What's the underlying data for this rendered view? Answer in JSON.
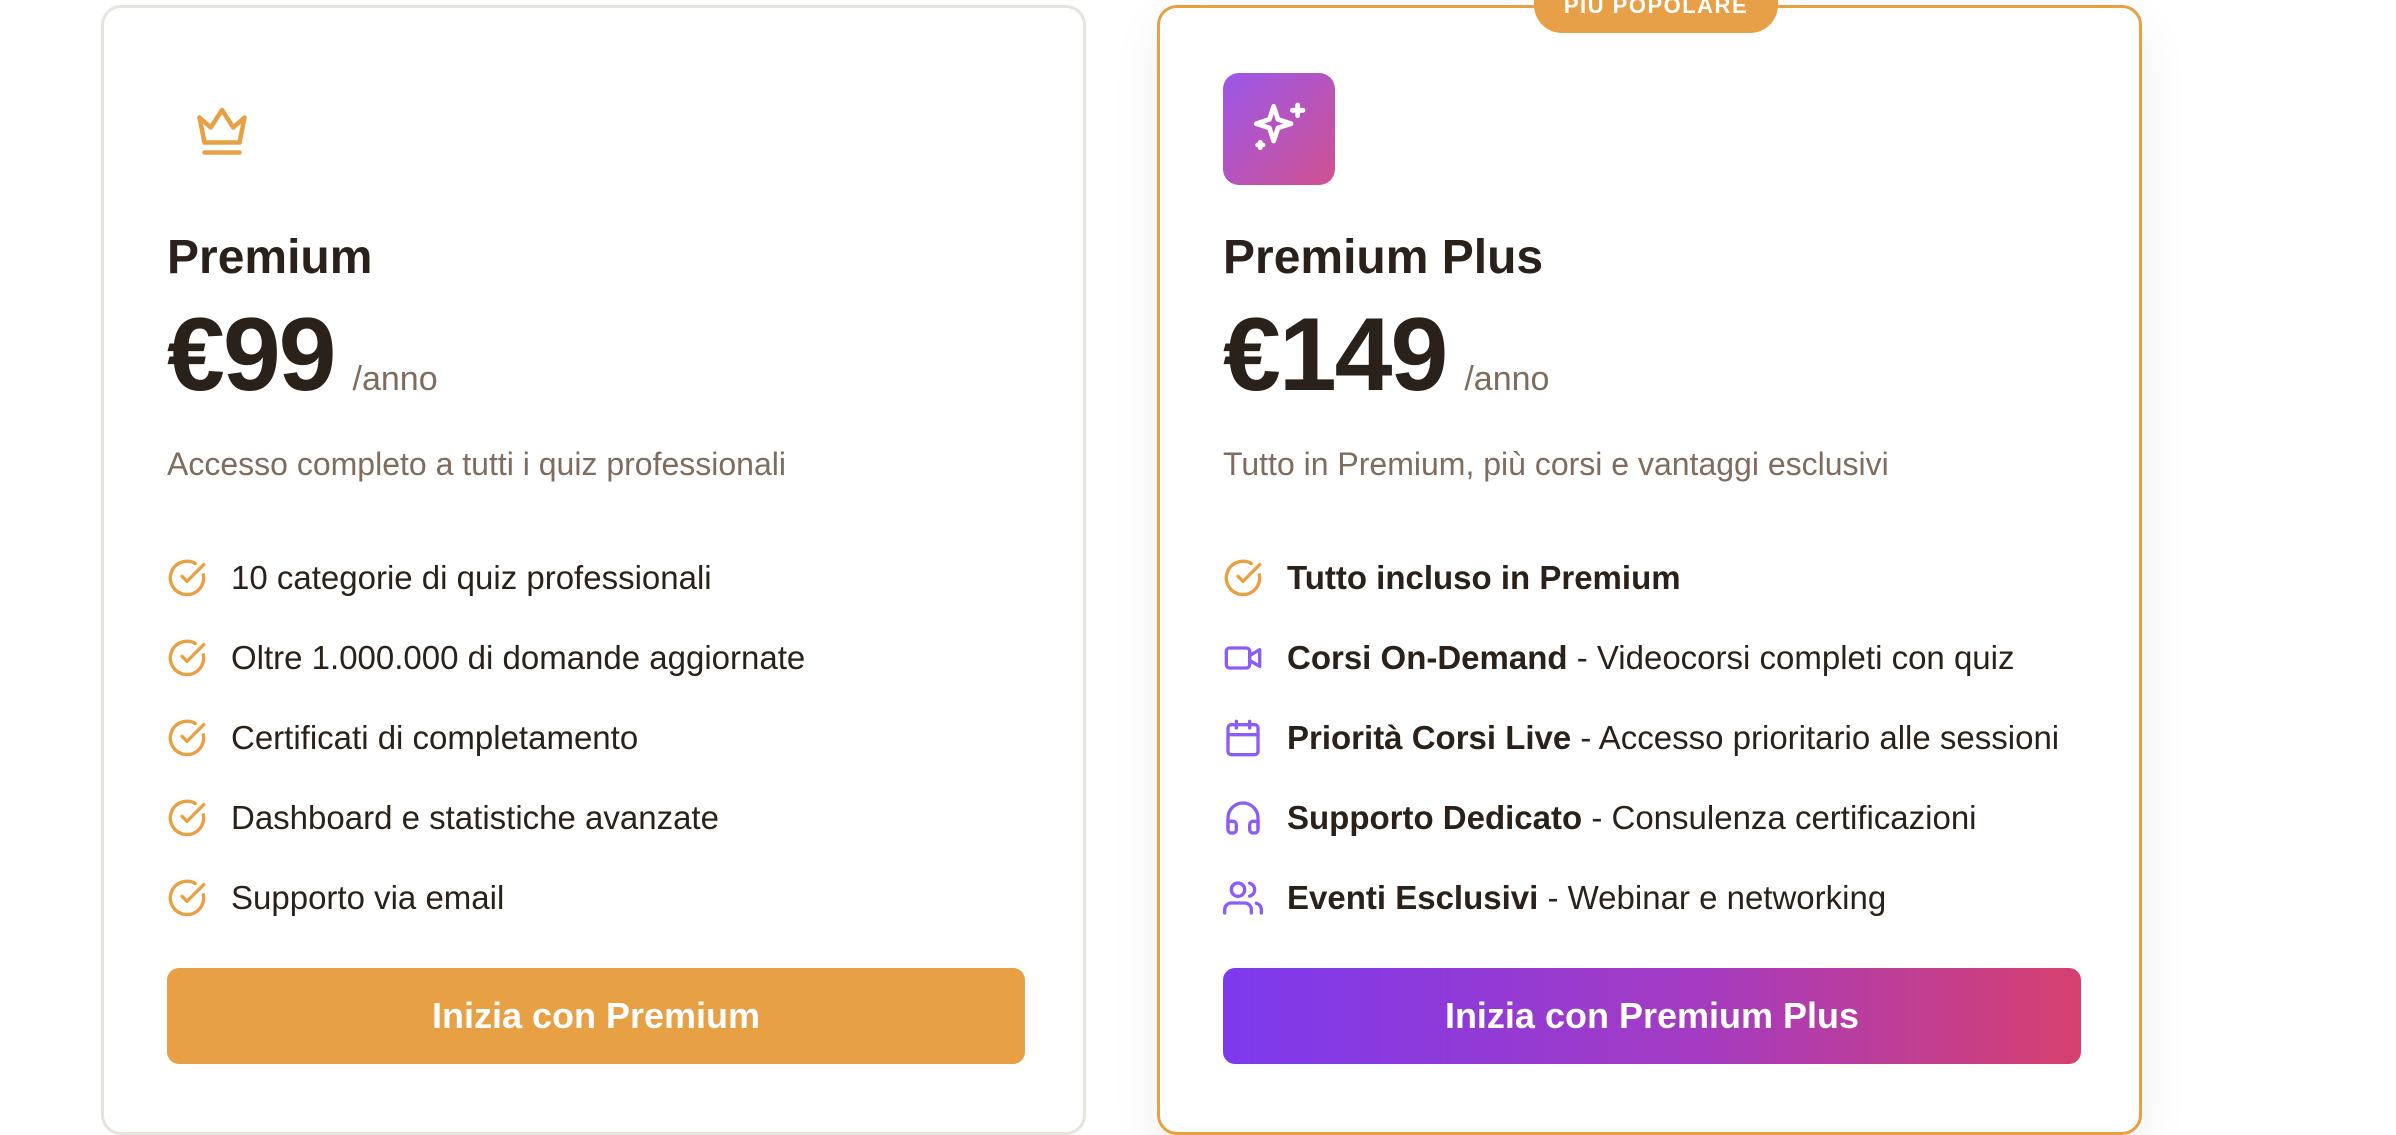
{
  "colors": {
    "accent_orange": "#e7a044",
    "accent_purple": "#8b5cf6",
    "text_dark": "#2b211b",
    "text_muted": "#806c5e",
    "gradient_start": "#7c3aed",
    "gradient_end": "#d6406e"
  },
  "plans": [
    {
      "icon": "crown-icon",
      "name": "Premium",
      "price": "€99",
      "period": "/anno",
      "description": "Accesso completo a tutti i quiz professionali",
      "features": [
        {
          "icon": "check-circle-icon",
          "strong": "",
          "text": "10 categorie di quiz professionali"
        },
        {
          "icon": "check-circle-icon",
          "strong": "",
          "text": "Oltre 1.000.000 di domande aggiornate"
        },
        {
          "icon": "check-circle-icon",
          "strong": "",
          "text": "Certificati di completamento"
        },
        {
          "icon": "check-circle-icon",
          "strong": "",
          "text": "Dashboard e statistiche avanzate"
        },
        {
          "icon": "check-circle-icon",
          "strong": "",
          "text": "Supporto via email"
        }
      ],
      "cta": "Inizia con Premium"
    },
    {
      "badge": "PIÙ POPOLARE",
      "icon": "sparkles-icon",
      "name": "Premium Plus",
      "price": "€149",
      "period": "/anno",
      "description": "Tutto in Premium, più corsi e vantaggi esclusivi",
      "features": [
        {
          "icon": "check-circle-icon",
          "strong": "Tutto incluso in Premium",
          "text": ""
        },
        {
          "icon": "video-icon",
          "strong": "Corsi On-Demand",
          "text": " - Videocorsi completi con quiz"
        },
        {
          "icon": "calendar-icon",
          "strong": "Priorità Corsi Live",
          "text": " - Accesso prioritario alle sessioni"
        },
        {
          "icon": "headphones-icon",
          "strong": "Supporto Dedicato",
          "text": " - Consulenza certificazioni"
        },
        {
          "icon": "users-icon",
          "strong": "Eventi Esclusivi",
          "text": " - Webinar e networking"
        }
      ],
      "cta": "Inizia con Premium Plus"
    }
  ]
}
